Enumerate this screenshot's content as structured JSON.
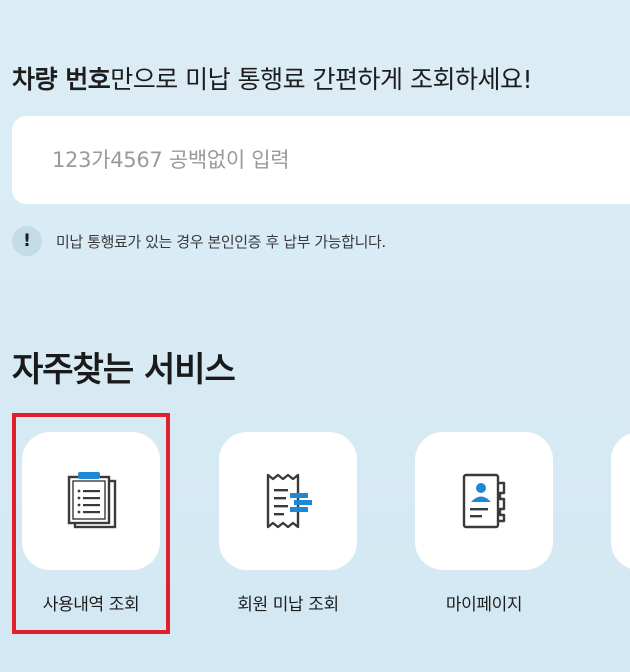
{
  "headline": {
    "bold": "차량 번호",
    "rest": "만으로 미납 통행료 간편하게 조회하세요!"
  },
  "search": {
    "placeholder": "123가4567 공백없이 입력",
    "value": ""
  },
  "notice": {
    "icon_text": "!",
    "text": "미납 통행료가 있는 경우 본인인증 후 납부 가능합니다."
  },
  "services": {
    "title": "자주찾는 서비스",
    "items": [
      {
        "label": "사용내역 조회",
        "icon": "clipboard-list-icon",
        "highlighted": true
      },
      {
        "label": "회원 미납 조회",
        "icon": "receipt-icon"
      },
      {
        "label": "마이페이지",
        "icon": "profile-card-icon"
      },
      {
        "label": "",
        "icon": "partial-tile"
      }
    ]
  },
  "colors": {
    "accent": "#1e88d6",
    "highlight_border": "#e0202a",
    "icon_stroke": "#3a3a3a",
    "background": "#d9ecf5"
  }
}
